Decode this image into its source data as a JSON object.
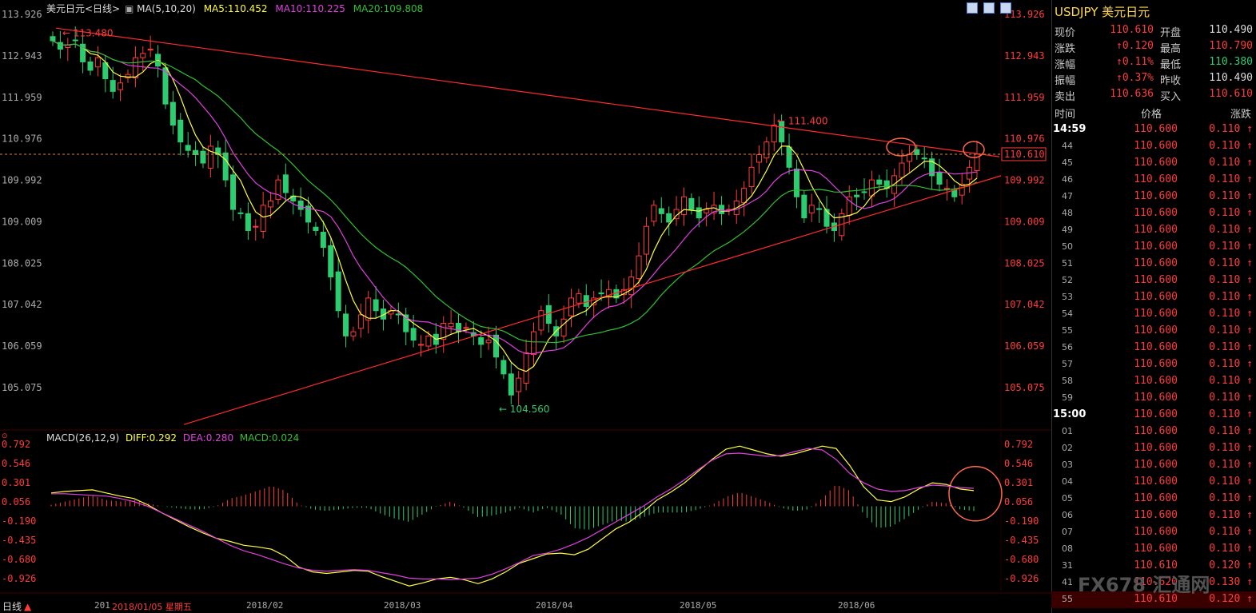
{
  "header": {
    "title": "美元日元<日线>",
    "ma_prefix": "MA(5,10,20)",
    "ma5": "MA5:110.452",
    "ma10": "MA10:110.225",
    "ma20": "MA20:109.808"
  },
  "macd_header": {
    "label": "MACD(26,12,9)",
    "diff": "DIFF:0.292",
    "dea": "DEA:0.280",
    "macd": "MACD:0.024"
  },
  "bottom": {
    "period_label": "日线",
    "date_partial": "201",
    "cursor_date": "2018/01/05 星期五",
    "months": [
      "2018/02",
      "2018/03",
      "2018/04",
      "2018/05",
      "2018/06"
    ]
  },
  "price_axis_left": [
    "113.926",
    "112.943",
    "111.959",
    "110.976",
    "109.992",
    "109.009",
    "108.025",
    "107.042",
    "106.059",
    "105.075"
  ],
  "price_axis_right": [
    "113.926",
    "112.943",
    "111.959",
    "110.976",
    "109.992",
    "109.009",
    "108.025",
    "107.042",
    "106.059",
    "105.075"
  ],
  "macd_axis_left": [
    "0.792",
    "0.546",
    "0.301",
    "0.056",
    "-0.190",
    "-0.435",
    "-0.680",
    "-0.926"
  ],
  "macd_axis_right": [
    "0.792",
    "0.546",
    "0.301",
    "0.056",
    "-0.190",
    "-0.435",
    "-0.680",
    "-0.926"
  ],
  "annotations": {
    "high_label": "113.480",
    "peak_label": "111.400",
    "low_label": "104.560",
    "last_price": "110.610"
  },
  "colors": {
    "up": "#ff3b3b",
    "down": "#2ecc71",
    "ma5": "#ffff3c",
    "ma10": "#e040e0",
    "ma20": "#30c030",
    "trend": "#ff2a2a",
    "diff": "#ffff3c",
    "dea": "#e040e0"
  },
  "chart_data": {
    "type": "candlestick",
    "title": "美元日元<日线>",
    "x_labels": [
      "2018/02",
      "2018/03",
      "2018/04",
      "2018/05",
      "2018/06"
    ],
    "y_axis_ticks": [
      113.926,
      112.943,
      111.959,
      110.976,
      109.992,
      109.009,
      108.025,
      107.042,
      106.059,
      105.075
    ],
    "annotated_points": {
      "high": 113.48,
      "secondary_high": 111.4,
      "low": 104.56,
      "last": 110.61
    },
    "moving_averages": {
      "MA5": 110.452,
      "MA10": 110.225,
      "MA20": 109.808
    },
    "macd": {
      "params": "26,12,9",
      "DIFF": 0.292,
      "DEA": 0.28,
      "MACD": 0.024,
      "y_axis_ticks": [
        0.792,
        0.546,
        0.301,
        0.056,
        -0.19,
        -0.435,
        -0.68,
        -0.926
      ]
    },
    "closes": [
      113.3,
      113.1,
      113.2,
      113.3,
      112.8,
      112.6,
      112.9,
      112.4,
      112.1,
      112.3,
      112.5,
      112.9,
      113.0,
      113.1,
      112.7,
      111.8,
      111.3,
      110.9,
      110.7,
      110.6,
      110.4,
      110.8,
      110.6,
      110.0,
      109.3,
      109.2,
      108.8,
      108.9,
      109.4,
      109.5,
      110.0,
      109.7,
      109.5,
      109.3,
      109.0,
      108.8,
      108.4,
      107.7,
      106.9,
      106.3,
      106.4,
      106.8,
      107.2,
      106.9,
      106.7,
      106.9,
      106.8,
      106.4,
      106.2,
      106.1,
      106.3,
      106.1,
      106.6,
      106.6,
      106.4,
      106.5,
      106.3,
      106.1,
      106.2,
      105.8,
      105.4,
      104.9,
      105.3,
      105.9,
      106.4,
      106.9,
      106.6,
      106.3,
      106.7,
      107.2,
      107.3,
      107.0,
      107.2,
      107.3,
      107.4,
      107.2,
      107.4,
      107.7,
      108.2,
      108.9,
      109.4,
      109.2,
      109.0,
      109.3,
      109.6,
      109.3,
      109.1,
      109.3,
      109.4,
      109.2,
      109.3,
      109.5,
      109.8,
      110.3,
      110.6,
      110.9,
      111.3,
      110.9,
      110.3,
      109.6,
      109.1,
      109.4,
      109.3,
      108.9,
      108.8,
      109.2,
      109.6,
      109.6,
      109.7,
      110.0,
      109.9,
      109.8,
      110.1,
      110.4,
      110.6,
      110.6,
      110.5,
      110.1,
      109.9,
      109.8,
      109.6,
      109.9,
      110.3,
      110.61
    ],
    "macd_diff": [
      0.17,
      0.19,
      0.2,
      0.21,
      0.17,
      0.13,
      0.1,
      0.02,
      -0.08,
      -0.17,
      -0.26,
      -0.34,
      -0.41,
      -0.45,
      -0.5,
      -0.52,
      -0.55,
      -0.64,
      -0.78,
      -0.84,
      -0.86,
      -0.84,
      -0.82,
      -0.83,
      -0.9,
      -0.96,
      -1.02,
      -0.98,
      -0.93,
      -0.91,
      -0.94,
      -0.99,
      -0.93,
      -0.84,
      -0.73,
      -0.67,
      -0.61,
      -0.6,
      -0.62,
      -0.55,
      -0.42,
      -0.29,
      -0.2,
      -0.07,
      0.08,
      0.18,
      0.3,
      0.45,
      0.6,
      0.73,
      0.77,
      0.72,
      0.67,
      0.64,
      0.67,
      0.72,
      0.77,
      0.74,
      0.52,
      0.25,
      0.08,
      0.06,
      0.12,
      0.22,
      0.3,
      0.28,
      0.22,
      0.2
    ],
    "macd_dea": [
      0.16,
      0.16,
      0.15,
      0.14,
      0.13,
      0.1,
      0.06,
      0.0,
      -0.08,
      -0.16,
      -0.24,
      -0.32,
      -0.41,
      -0.5,
      -0.57,
      -0.62,
      -0.68,
      -0.74,
      -0.79,
      -0.82,
      -0.83,
      -0.82,
      -0.81,
      -0.82,
      -0.85,
      -0.88,
      -0.92,
      -0.93,
      -0.93,
      -0.94,
      -0.93,
      -0.92,
      -0.87,
      -0.8,
      -0.72,
      -0.63,
      -0.6,
      -0.55,
      -0.48,
      -0.4,
      -0.3,
      -0.2,
      -0.1,
      0.0,
      0.12,
      0.22,
      0.34,
      0.47,
      0.59,
      0.67,
      0.68,
      0.66,
      0.64,
      0.65,
      0.7,
      0.74,
      0.72,
      0.6,
      0.42,
      0.3,
      0.22,
      0.19,
      0.2,
      0.24,
      0.27,
      0.26,
      0.24,
      0.23
    ]
  }
}
